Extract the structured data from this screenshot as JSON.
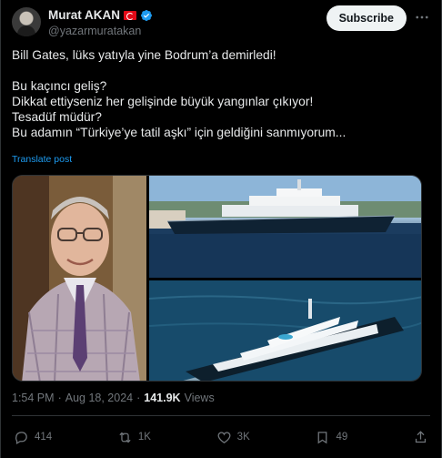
{
  "author": {
    "display_name": "Murat AKAN",
    "handle": "@yazarmuratakan",
    "flag": "turkey-flag",
    "verified": true
  },
  "header": {
    "subscribe_label": "Subscribe",
    "more_icon": "more-dots-icon"
  },
  "tweet": {
    "line1": "Bill Gates, lüks yatıyla yine Bodrum’a demirledi!",
    "line2": "Bu kaçıncı geliş?",
    "line3": "Dikkat ettiyseniz her gelişinde büyük yangınlar çıkıyor!",
    "line4": "Tesadüf müdür?",
    "line5": "Bu adamın “Türkiye’ye tatil aşkı” için geldiğini sanmıyorum...",
    "translate_label": "Translate post"
  },
  "meta": {
    "time": "1:54 PM",
    "separator": "·",
    "date": "Aug 18, 2024",
    "separator2": "·",
    "views_count": "141.9K",
    "views_label": "Views"
  },
  "actions": {
    "replies": "414",
    "reposts": "1K",
    "likes": "3K",
    "bookmarks": "49"
  },
  "colors": {
    "background": "#000000",
    "text": "#e7e9ea",
    "muted": "#71767b",
    "link": "#1d9bf0",
    "verified": "#1d9bf0",
    "border": "#2f3336"
  }
}
